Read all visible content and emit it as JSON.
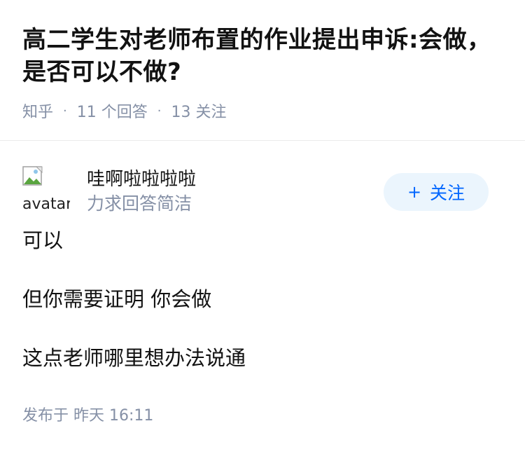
{
  "question": {
    "title": "高二学生对老师布置的作业提出申诉:会做，是否可以不做?",
    "source": "知乎",
    "answers_count_label": "11 个回答",
    "followers_count_label": "13 关注"
  },
  "answer": {
    "author": {
      "name": "哇啊啦啦啦啦",
      "headline": "力求回答简洁",
      "avatar_alt": "avatar"
    },
    "follow_button": {
      "icon": "+",
      "label": "关注"
    },
    "paragraphs": [
      "可以",
      "但你需要证明 你会做",
      "这点老师哪里想办法说通"
    ],
    "published_label": "发布于 昨天 16:11"
  },
  "colors": {
    "text_primary": "#121212",
    "text_secondary": "#8590a6",
    "accent": "#0066ff",
    "follow_bg": "#ebf5fd"
  }
}
